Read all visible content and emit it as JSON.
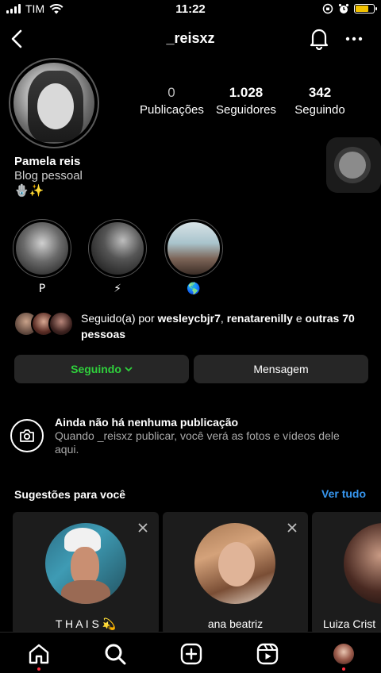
{
  "status_bar": {
    "carrier": "TIM",
    "time": "11:22",
    "battery_color": "#f2c200",
    "battery_level": 0.75
  },
  "header": {
    "username": "_reisxz"
  },
  "stats": [
    {
      "value": "0",
      "label": "Publicações"
    },
    {
      "value": "1.028",
      "label": "Seguidores"
    },
    {
      "value": "342",
      "label": "Seguindo"
    }
  ],
  "profile": {
    "name": "Pamela reis",
    "category": "Blog pessoal",
    "bio_emoji": "🪬✨"
  },
  "highlights": [
    {
      "label": "P"
    },
    {
      "label": "⚡"
    },
    {
      "label": "🌎"
    }
  ],
  "followed_by": {
    "prefix": "Seguido(a) por ",
    "user1": "wesleycbjr7",
    "separator": ", ",
    "user2": "renatarenilly",
    "middle": " e ",
    "others": "outras 70 pessoas"
  },
  "actions": {
    "following_label": "Seguindo",
    "message_label": "Mensagem",
    "following_color": "#2fd13c"
  },
  "empty_state": {
    "title": "Ainda não há nenhuma publicação",
    "description": "Quando _reisxz publicar, você verá as fotos e vídeos dele aqui."
  },
  "suggestions": {
    "title": "Sugestões para você",
    "see_all": "Ver tudo",
    "accent_color": "#3797f0",
    "cards": [
      {
        "name": "T H A I S 💫"
      },
      {
        "name": "ana beatriz"
      },
      {
        "name": "Luiza Crist"
      }
    ]
  },
  "bottom_nav": [
    {
      "icon": "home-icon"
    },
    {
      "icon": "search-icon"
    },
    {
      "icon": "create-icon"
    },
    {
      "icon": "reels-icon"
    },
    {
      "icon": "profile-avatar"
    }
  ]
}
